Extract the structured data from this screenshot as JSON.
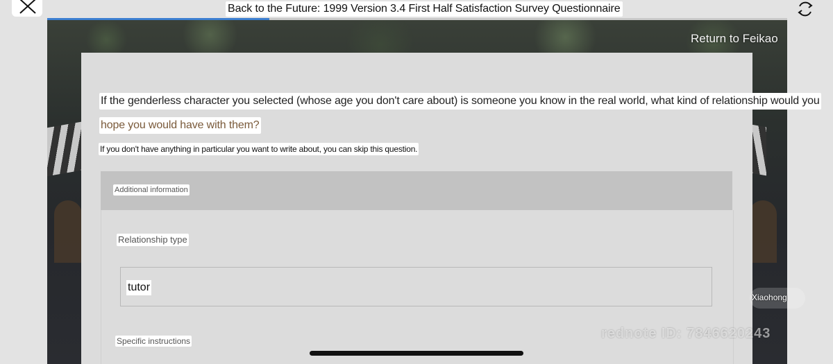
{
  "header": {
    "title": "Back to the Future: 1999 Version 3.4 First Half Satisfaction Survey Questionnaire",
    "close_icon": "close-icon",
    "refresh_icon": "refresh-icon",
    "progress": 0.3
  },
  "nav": {
    "return_label": "Return to Feikao"
  },
  "question": {
    "text_line1": "If the genderless character you selected (whose age you don't care about) is someone you know in the real world, what kind of relationship would you",
    "text_line2": "hope you would have with them?",
    "hint": "If you don't have anything in particular you want to write about, you can skip this question."
  },
  "section": {
    "header": "Additional information",
    "relationship_label": "Relationship type",
    "relationship_value": "tutor",
    "specific_label": "Specific instructions"
  },
  "watermark": {
    "user": "Xiaohong",
    "id": "rednote ID: 7846620243"
  },
  "colors": {
    "progress": "#3d7fd1",
    "question_accent": "#7a5a3a"
  }
}
